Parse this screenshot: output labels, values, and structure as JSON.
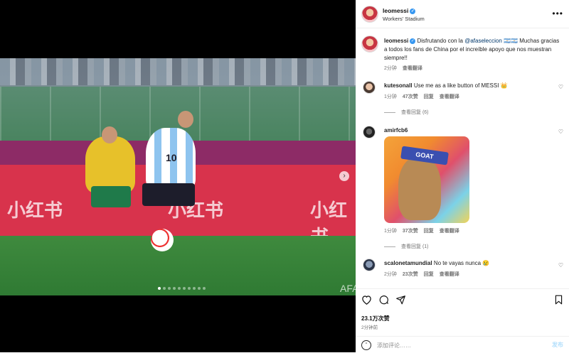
{
  "post": {
    "author": "leomessi",
    "location": "Workers' Stadium",
    "caption_author": "leomessi",
    "caption_pre": "Disfrutando con la",
    "caption_mention": "@afaseleccion",
    "caption_flags": "🇦🇷🇦🇷",
    "caption_post": "Muchas gracias a todos los fans de China por el increíble apoyo que nos muestran siempre!!",
    "caption_time": "2分钟",
    "caption_translate": "查看翻译",
    "carousel": {
      "count": 10,
      "active_index": 0
    },
    "ad_text": "小红书",
    "jersey_number": "10",
    "watermark": "AFA"
  },
  "comments": [
    {
      "user": "kutesonall",
      "text": "Use me as a like button of MESSI",
      "emoji": "👑",
      "time": "1分钟",
      "likes": "47次赞",
      "reply": "回复",
      "translate": "查看翻译",
      "replies_label": "查看回复 (6)"
    },
    {
      "user": "amirfcb6",
      "text": "",
      "image_label": "GOAT",
      "time": "1分钟",
      "likes": "37次赞",
      "reply": "回复",
      "translate": "查看翻译",
      "replies_label": "查看回复 (1)"
    },
    {
      "user": "scalonetamundial",
      "text": "No te vayas nunca",
      "emoji": "😢",
      "time": "2分钟",
      "likes": "23次赞",
      "reply": "回复",
      "translate": "查看翻译"
    }
  ],
  "actions": {
    "likes": "23.1万次赞",
    "time_ago": "2分钟前",
    "comment_placeholder": "添加评论……",
    "post_label": "发布"
  },
  "colors": {
    "verified": "#3797f0",
    "mention": "#00376b",
    "muted": "#737373"
  }
}
